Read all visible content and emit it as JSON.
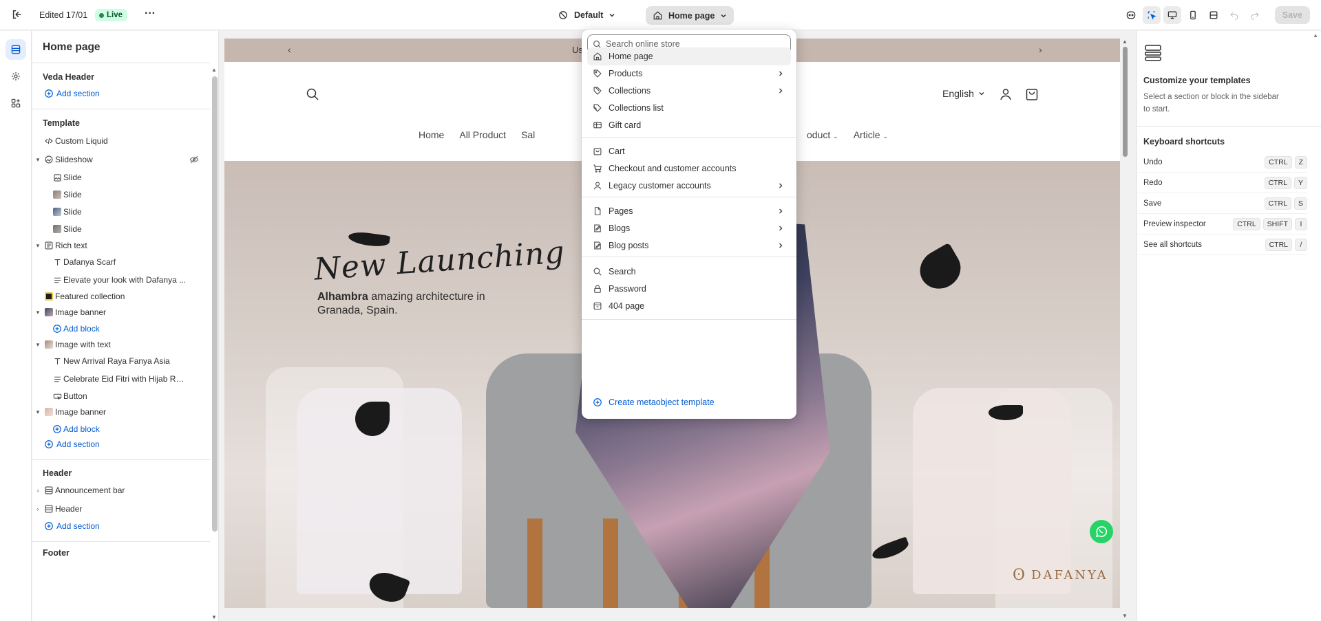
{
  "topbar": {
    "edited": "Edited 17/01",
    "live": "Live",
    "theme": "Default",
    "page": "Home page",
    "save": "Save"
  },
  "sidebar": {
    "title": "Home page",
    "groups": {
      "header_group": "Veda Header",
      "template": "Template",
      "header": "Header",
      "footer": "Footer"
    },
    "add_section": "Add section",
    "add_block": "Add block",
    "items": {
      "custom_liquid": "Custom Liquid",
      "slideshow": "Slideshow",
      "slide_1": "Slide",
      "slide_2": "Slide",
      "slide_3": "Slide",
      "slide_4": "Slide",
      "rich_text": "Rich text",
      "rich_heading": "Dafanya Scarf",
      "rich_body": "Elevate your look with Dafanya ...",
      "featured_collection": "Featured collection",
      "image_banner_1": "Image banner",
      "image_with_text": "Image with text",
      "iwt_heading": "New Arrival Raya Fanya Asia",
      "iwt_body": "Celebrate Eid Fitri with Hijab Ra...",
      "iwt_button": "Button",
      "image_banner_2": "Image banner",
      "announcement_bar": "Announcement bar",
      "header": "Header"
    }
  },
  "preview": {
    "announcement": "Us",
    "language": "English",
    "nav": [
      "Home",
      "All Product",
      "Sal"
    ],
    "nav_right": [
      "oduct",
      "Article"
    ],
    "hero_headline": "New Launching",
    "hero_sub_bold": "Alhambra",
    "hero_sub_line1": " amazing architecture in",
    "hero_sub_line2": "Granada, Spain.",
    "brand": "DAFANYA"
  },
  "dropdown": {
    "search_placeholder": "Search online store",
    "items": [
      {
        "label": "Home page",
        "icon": "home-icon",
        "chevron": false,
        "selected": true
      },
      {
        "label": "Products",
        "icon": "tag-icon",
        "chevron": true
      },
      {
        "label": "Collections",
        "icon": "collection-icon",
        "chevron": true
      },
      {
        "label": "Collections list",
        "icon": "collections-list-icon",
        "chevron": false
      },
      {
        "label": "Gift card",
        "icon": "gift-card-icon",
        "chevron": false
      },
      {
        "label": "Cart",
        "icon": "cart-icon",
        "chevron": false
      },
      {
        "label": "Checkout and customer accounts",
        "icon": "checkout-icon",
        "chevron": false
      },
      {
        "label": "Legacy customer accounts",
        "icon": "person-icon",
        "chevron": true
      },
      {
        "label": "Pages",
        "icon": "page-icon",
        "chevron": true
      },
      {
        "label": "Blogs",
        "icon": "blog-icon",
        "chevron": true
      },
      {
        "label": "Blog posts",
        "icon": "blog-post-icon",
        "chevron": true
      },
      {
        "label": "Search",
        "icon": "search-icon",
        "chevron": false
      },
      {
        "label": "Password",
        "icon": "lock-icon",
        "chevron": false
      },
      {
        "label": "404 page",
        "icon": "error-page-icon",
        "chevron": false
      }
    ],
    "create": "Create metaobject template"
  },
  "right_panel": {
    "title": "Customize your templates",
    "description": "Select a section or block in the sidebar to start.",
    "shortcuts_title": "Keyboard shortcuts",
    "shortcuts": [
      {
        "label": "Undo",
        "keys": [
          "CTRL",
          "Z"
        ]
      },
      {
        "label": "Redo",
        "keys": [
          "CTRL",
          "Y"
        ]
      },
      {
        "label": "Save",
        "keys": [
          "CTRL",
          "S"
        ]
      },
      {
        "label": "Preview inspector",
        "keys": [
          "CTRL",
          "SHIFT",
          "I"
        ]
      },
      {
        "label": "See all shortcuts",
        "keys": [
          "CTRL",
          "/"
        ]
      }
    ]
  },
  "colors": {
    "accent": "#005bd3",
    "live_bg": "#cdfee1",
    "live_dot": "#29845a",
    "announcement_bg": "#c5b6ae"
  }
}
